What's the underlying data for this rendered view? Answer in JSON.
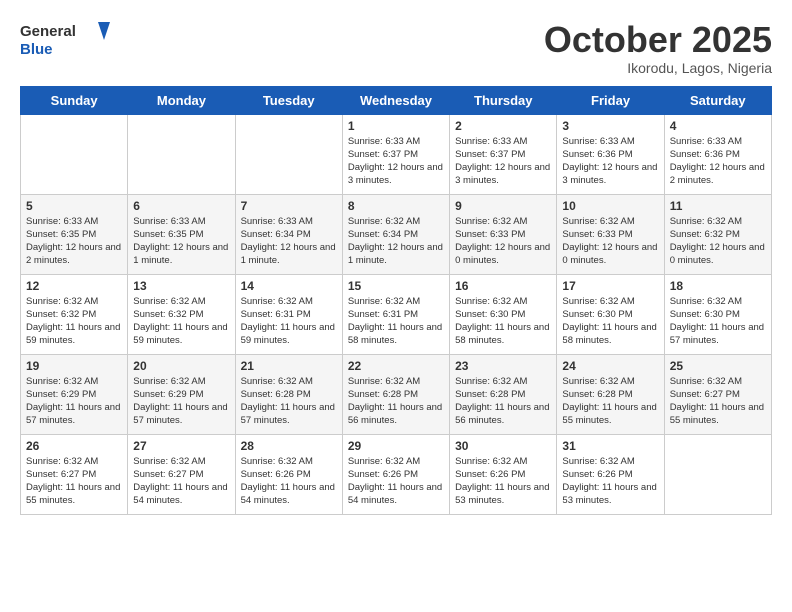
{
  "header": {
    "logo_line1": "General",
    "logo_line2": "Blue",
    "month": "October 2025",
    "location": "Ikorodu, Lagos, Nigeria"
  },
  "weekdays": [
    "Sunday",
    "Monday",
    "Tuesday",
    "Wednesday",
    "Thursday",
    "Friday",
    "Saturday"
  ],
  "weeks": [
    [
      {
        "day": "",
        "sunrise": "",
        "sunset": "",
        "daylight": ""
      },
      {
        "day": "",
        "sunrise": "",
        "sunset": "",
        "daylight": ""
      },
      {
        "day": "",
        "sunrise": "",
        "sunset": "",
        "daylight": ""
      },
      {
        "day": "1",
        "sunrise": "Sunrise: 6:33 AM",
        "sunset": "Sunset: 6:37 PM",
        "daylight": "Daylight: 12 hours and 3 minutes."
      },
      {
        "day": "2",
        "sunrise": "Sunrise: 6:33 AM",
        "sunset": "Sunset: 6:37 PM",
        "daylight": "Daylight: 12 hours and 3 minutes."
      },
      {
        "day": "3",
        "sunrise": "Sunrise: 6:33 AM",
        "sunset": "Sunset: 6:36 PM",
        "daylight": "Daylight: 12 hours and 3 minutes."
      },
      {
        "day": "4",
        "sunrise": "Sunrise: 6:33 AM",
        "sunset": "Sunset: 6:36 PM",
        "daylight": "Daylight: 12 hours and 2 minutes."
      }
    ],
    [
      {
        "day": "5",
        "sunrise": "Sunrise: 6:33 AM",
        "sunset": "Sunset: 6:35 PM",
        "daylight": "Daylight: 12 hours and 2 minutes."
      },
      {
        "day": "6",
        "sunrise": "Sunrise: 6:33 AM",
        "sunset": "Sunset: 6:35 PM",
        "daylight": "Daylight: 12 hours and 1 minute."
      },
      {
        "day": "7",
        "sunrise": "Sunrise: 6:33 AM",
        "sunset": "Sunset: 6:34 PM",
        "daylight": "Daylight: 12 hours and 1 minute."
      },
      {
        "day": "8",
        "sunrise": "Sunrise: 6:32 AM",
        "sunset": "Sunset: 6:34 PM",
        "daylight": "Daylight: 12 hours and 1 minute."
      },
      {
        "day": "9",
        "sunrise": "Sunrise: 6:32 AM",
        "sunset": "Sunset: 6:33 PM",
        "daylight": "Daylight: 12 hours and 0 minutes."
      },
      {
        "day": "10",
        "sunrise": "Sunrise: 6:32 AM",
        "sunset": "Sunset: 6:33 PM",
        "daylight": "Daylight: 12 hours and 0 minutes."
      },
      {
        "day": "11",
        "sunrise": "Sunrise: 6:32 AM",
        "sunset": "Sunset: 6:32 PM",
        "daylight": "Daylight: 12 hours and 0 minutes."
      }
    ],
    [
      {
        "day": "12",
        "sunrise": "Sunrise: 6:32 AM",
        "sunset": "Sunset: 6:32 PM",
        "daylight": "Daylight: 11 hours and 59 minutes."
      },
      {
        "day": "13",
        "sunrise": "Sunrise: 6:32 AM",
        "sunset": "Sunset: 6:32 PM",
        "daylight": "Daylight: 11 hours and 59 minutes."
      },
      {
        "day": "14",
        "sunrise": "Sunrise: 6:32 AM",
        "sunset": "Sunset: 6:31 PM",
        "daylight": "Daylight: 11 hours and 59 minutes."
      },
      {
        "day": "15",
        "sunrise": "Sunrise: 6:32 AM",
        "sunset": "Sunset: 6:31 PM",
        "daylight": "Daylight: 11 hours and 58 minutes."
      },
      {
        "day": "16",
        "sunrise": "Sunrise: 6:32 AM",
        "sunset": "Sunset: 6:30 PM",
        "daylight": "Daylight: 11 hours and 58 minutes."
      },
      {
        "day": "17",
        "sunrise": "Sunrise: 6:32 AM",
        "sunset": "Sunset: 6:30 PM",
        "daylight": "Daylight: 11 hours and 58 minutes."
      },
      {
        "day": "18",
        "sunrise": "Sunrise: 6:32 AM",
        "sunset": "Sunset: 6:30 PM",
        "daylight": "Daylight: 11 hours and 57 minutes."
      }
    ],
    [
      {
        "day": "19",
        "sunrise": "Sunrise: 6:32 AM",
        "sunset": "Sunset: 6:29 PM",
        "daylight": "Daylight: 11 hours and 57 minutes."
      },
      {
        "day": "20",
        "sunrise": "Sunrise: 6:32 AM",
        "sunset": "Sunset: 6:29 PM",
        "daylight": "Daylight: 11 hours and 57 minutes."
      },
      {
        "day": "21",
        "sunrise": "Sunrise: 6:32 AM",
        "sunset": "Sunset: 6:28 PM",
        "daylight": "Daylight: 11 hours and 57 minutes."
      },
      {
        "day": "22",
        "sunrise": "Sunrise: 6:32 AM",
        "sunset": "Sunset: 6:28 PM",
        "daylight": "Daylight: 11 hours and 56 minutes."
      },
      {
        "day": "23",
        "sunrise": "Sunrise: 6:32 AM",
        "sunset": "Sunset: 6:28 PM",
        "daylight": "Daylight: 11 hours and 56 minutes."
      },
      {
        "day": "24",
        "sunrise": "Sunrise: 6:32 AM",
        "sunset": "Sunset: 6:28 PM",
        "daylight": "Daylight: 11 hours and 55 minutes."
      },
      {
        "day": "25",
        "sunrise": "Sunrise: 6:32 AM",
        "sunset": "Sunset: 6:27 PM",
        "daylight": "Daylight: 11 hours and 55 minutes."
      }
    ],
    [
      {
        "day": "26",
        "sunrise": "Sunrise: 6:32 AM",
        "sunset": "Sunset: 6:27 PM",
        "daylight": "Daylight: 11 hours and 55 minutes."
      },
      {
        "day": "27",
        "sunrise": "Sunrise: 6:32 AM",
        "sunset": "Sunset: 6:27 PM",
        "daylight": "Daylight: 11 hours and 54 minutes."
      },
      {
        "day": "28",
        "sunrise": "Sunrise: 6:32 AM",
        "sunset": "Sunset: 6:26 PM",
        "daylight": "Daylight: 11 hours and 54 minutes."
      },
      {
        "day": "29",
        "sunrise": "Sunrise: 6:32 AM",
        "sunset": "Sunset: 6:26 PM",
        "daylight": "Daylight: 11 hours and 54 minutes."
      },
      {
        "day": "30",
        "sunrise": "Sunrise: 6:32 AM",
        "sunset": "Sunset: 6:26 PM",
        "daylight": "Daylight: 11 hours and 53 minutes."
      },
      {
        "day": "31",
        "sunrise": "Sunrise: 6:32 AM",
        "sunset": "Sunset: 6:26 PM",
        "daylight": "Daylight: 11 hours and 53 minutes."
      },
      {
        "day": "",
        "sunrise": "",
        "sunset": "",
        "daylight": ""
      }
    ]
  ]
}
